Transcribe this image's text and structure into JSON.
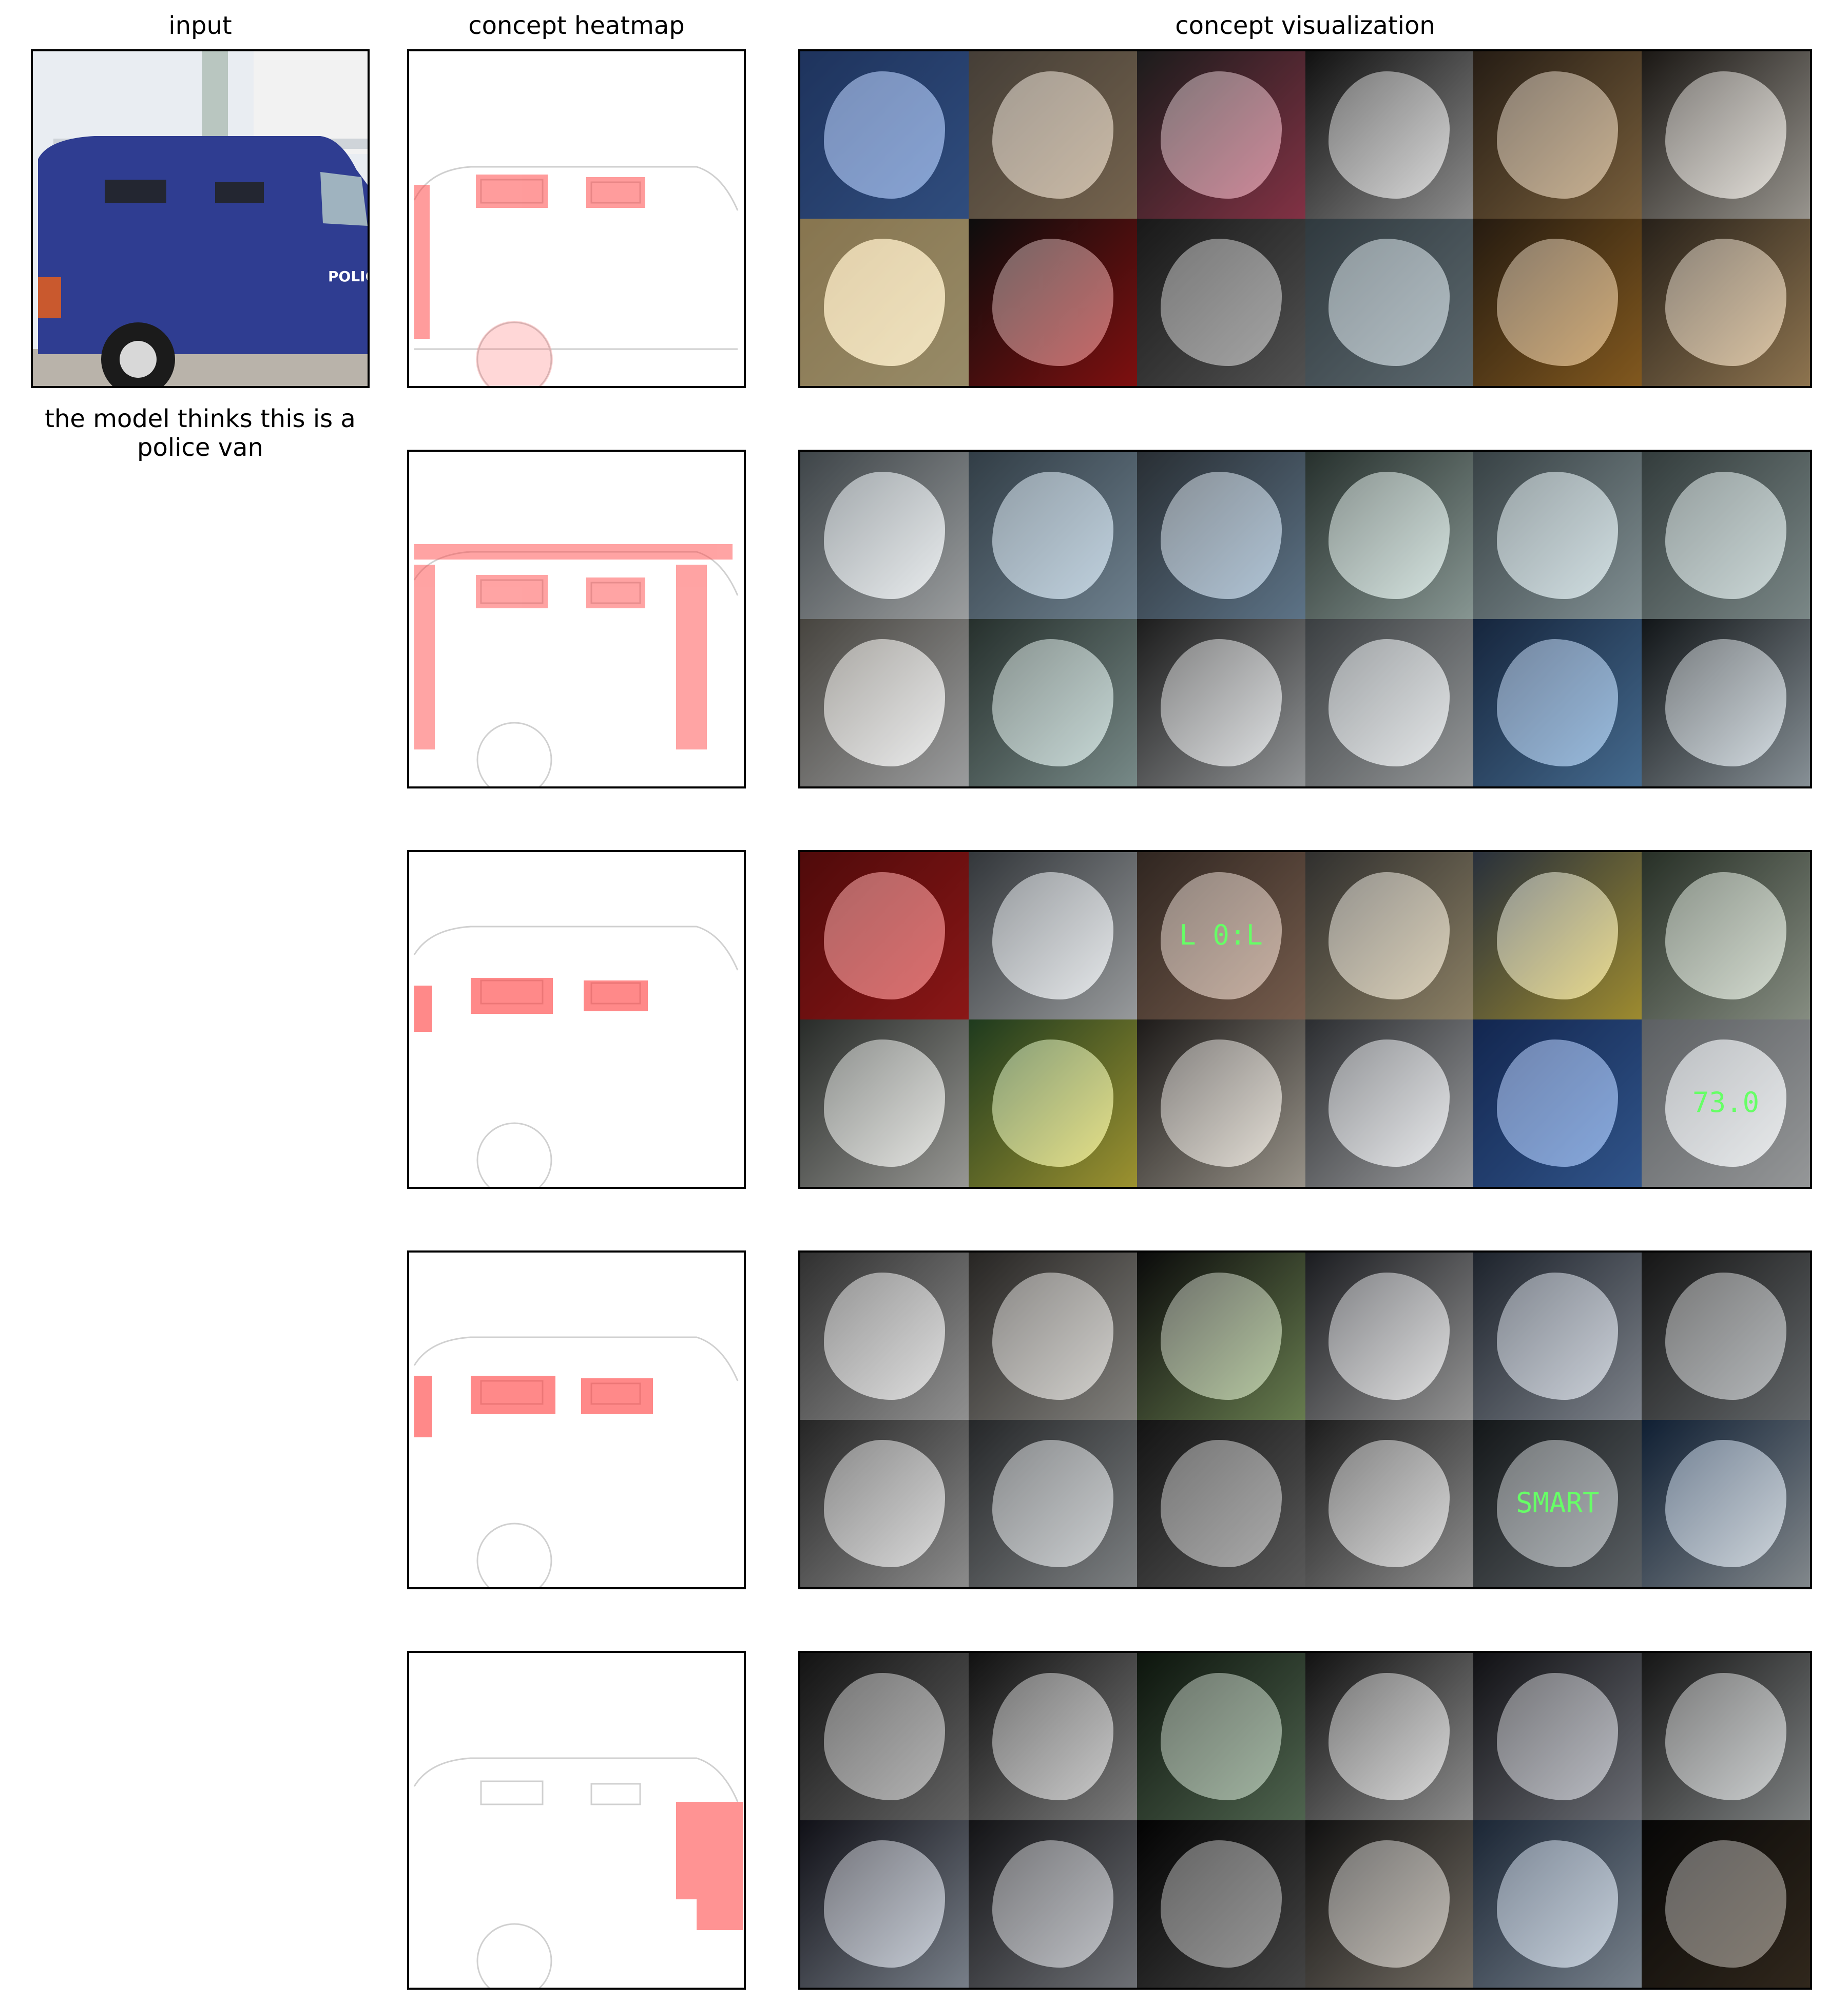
{
  "headers": {
    "input": "input",
    "heatmap": "concept heatmap",
    "visualization": "concept visualization"
  },
  "caption": "the model thinks this is a police van",
  "input_image": {
    "van_text": "POLIC"
  },
  "concept_rows": [
    {
      "id": "row-1",
      "tiles": [
        {
          "colors": [
            "#2f4f8f",
            "#4a77c2"
          ]
        },
        {
          "colors": [
            "#6a6055",
            "#b59a78"
          ]
        },
        {
          "colors": [
            "#2b2b2b",
            "#c84d6a"
          ]
        },
        {
          "colors": [
            "#1b1b1b",
            "#d8d8d8"
          ]
        },
        {
          "colors": [
            "#3b2d20",
            "#b9925c"
          ]
        },
        {
          "colors": [
            "#2a2520",
            "#e9e4da"
          ]
        },
        {
          "colors": [
            "#d0b47a",
            "#e9d6a0"
          ]
        },
        {
          "colors": [
            "#141414",
            "#c21818"
          ]
        },
        {
          "colors": [
            "#262626",
            "#7e7e7e"
          ]
        },
        {
          "colors": [
            "#4a5961",
            "#8fa2ab"
          ]
        },
        {
          "colors": [
            "#3a2a1a",
            "#c7882f"
          ]
        },
        {
          "colors": [
            "#3d3328",
            "#d9b27a"
          ]
        }
      ]
    },
    {
      "id": "row-2",
      "tiles": [
        {
          "colors": [
            "#606a70",
            "#eef2f4"
          ]
        },
        {
          "colors": [
            "#4d5f6c",
            "#a9c5da"
          ]
        },
        {
          "colors": [
            "#3f4850",
            "#8fb1cf"
          ]
        },
        {
          "colors": [
            "#3c4b46",
            "#cfe6e0"
          ]
        },
        {
          "colors": [
            "#56656a",
            "#c5dbe0"
          ]
        },
        {
          "colors": [
            "#4f5d5d",
            "#bcd0cf"
          ]
        },
        {
          "colors": [
            "#6e6a62",
            "#eef0f2"
          ]
        },
        {
          "colors": [
            "#3b4a45",
            "#b7d3d0"
          ]
        },
        {
          "colors": [
            "#2d2d2d",
            "#dfe3e6"
          ]
        },
        {
          "colors": [
            "#5c6266",
            "#e4e8ea"
          ]
        },
        {
          "colors": [
            "#223a5e",
            "#6aa3da"
          ]
        },
        {
          "colors": [
            "#1c2226",
            "#cfdde6"
          ]
        }
      ]
    },
    {
      "id": "row-3",
      "tiles": [
        {
          "colors": [
            "#7a1010",
            "#d52424"
          ]
        },
        {
          "colors": [
            "#4f555b",
            "#e8ecef"
          ]
        },
        {
          "colors": [
            "#4a3b33",
            "#b58e76"
          ],
          "text": "L 0:L"
        },
        {
          "colors": [
            "#4b4a48",
            "#d6c49a"
          ]
        },
        {
          "colors": [
            "#3e4a5c",
            "#f1d54a"
          ]
        },
        {
          "colors": [
            "#3d4a3c",
            "#cdd8c6"
          ]
        },
        {
          "colors": [
            "#3f4440",
            "#e8e8e3"
          ]
        },
        {
          "colors": [
            "#2f5a2f",
            "#f0e04a"
          ]
        },
        {
          "colors": [
            "#2e2a28",
            "#e9e1d2"
          ]
        },
        {
          "colors": [
            "#44474c",
            "#eef0f3"
          ]
        },
        {
          "colors": [
            "#1d3b7a",
            "#4b82d4"
          ]
        },
        {
          "colors": [
            "#8e9398",
            "#e5e8ea"
          ],
          "text": "73.0"
        }
      ]
    },
    {
      "id": "row-4",
      "tiles": [
        {
          "colors": [
            "#4a4a4a",
            "#dedede"
          ]
        },
        {
          "colors": [
            "#3d3a37",
            "#c8c6c0"
          ]
        },
        {
          "colors": [
            "#111111",
            "#9fbf7a"
          ]
        },
        {
          "colors": [
            "#2a2c32",
            "#e3e3e3"
          ]
        },
        {
          "colors": [
            "#2d3644",
            "#bfc7d3"
          ]
        },
        {
          "colors": [
            "#222222",
            "#9aa0a4"
          ]
        },
        {
          "colors": [
            "#3a3a3a",
            "#d7d7d7"
          ]
        },
        {
          "colors": [
            "#3a3d40",
            "#bfc4c7"
          ]
        },
        {
          "colors": [
            "#1f1f1f",
            "#8a8a8a"
          ]
        },
        {
          "colors": [
            "#2c2c2c",
            "#dadada"
          ]
        },
        {
          "colors": [
            "#1f2427",
            "#8c949a"
          ],
          "text": "SMART"
        },
        {
          "colors": [
            "#18304f",
            "#c7d0d6"
          ]
        }
      ]
    },
    {
      "id": "row-5",
      "tiles": [
        {
          "colors": [
            "#1e1e1e",
            "#9a9a9a"
          ]
        },
        {
          "colors": [
            "#1b1b1b",
            "#bfbfbf"
          ]
        },
        {
          "colors": [
            "#142014",
            "#7a9a7a"
          ]
        },
        {
          "colors": [
            "#1d1d1d",
            "#d9d9d9"
          ]
        },
        {
          "colors": [
            "#1a1a1f",
            "#a4a8b3"
          ]
        },
        {
          "colors": [
            "#222222",
            "#c2c7c8"
          ]
        },
        {
          "colors": [
            "#1a1a24",
            "#b8c3d2"
          ]
        },
        {
          "colors": [
            "#1e1e22",
            "#a9adb5"
          ]
        },
        {
          "colors": [
            "#050505",
            "#6a6a6a"
          ]
        },
        {
          "colors": [
            "#1a1a1a",
            "#b2a89a"
          ]
        },
        {
          "colors": [
            "#2a3b52",
            "#b7c6d6"
          ]
        },
        {
          "colors": [
            "#0b0b0b",
            "#4b3d2c"
          ]
        }
      ]
    }
  ]
}
